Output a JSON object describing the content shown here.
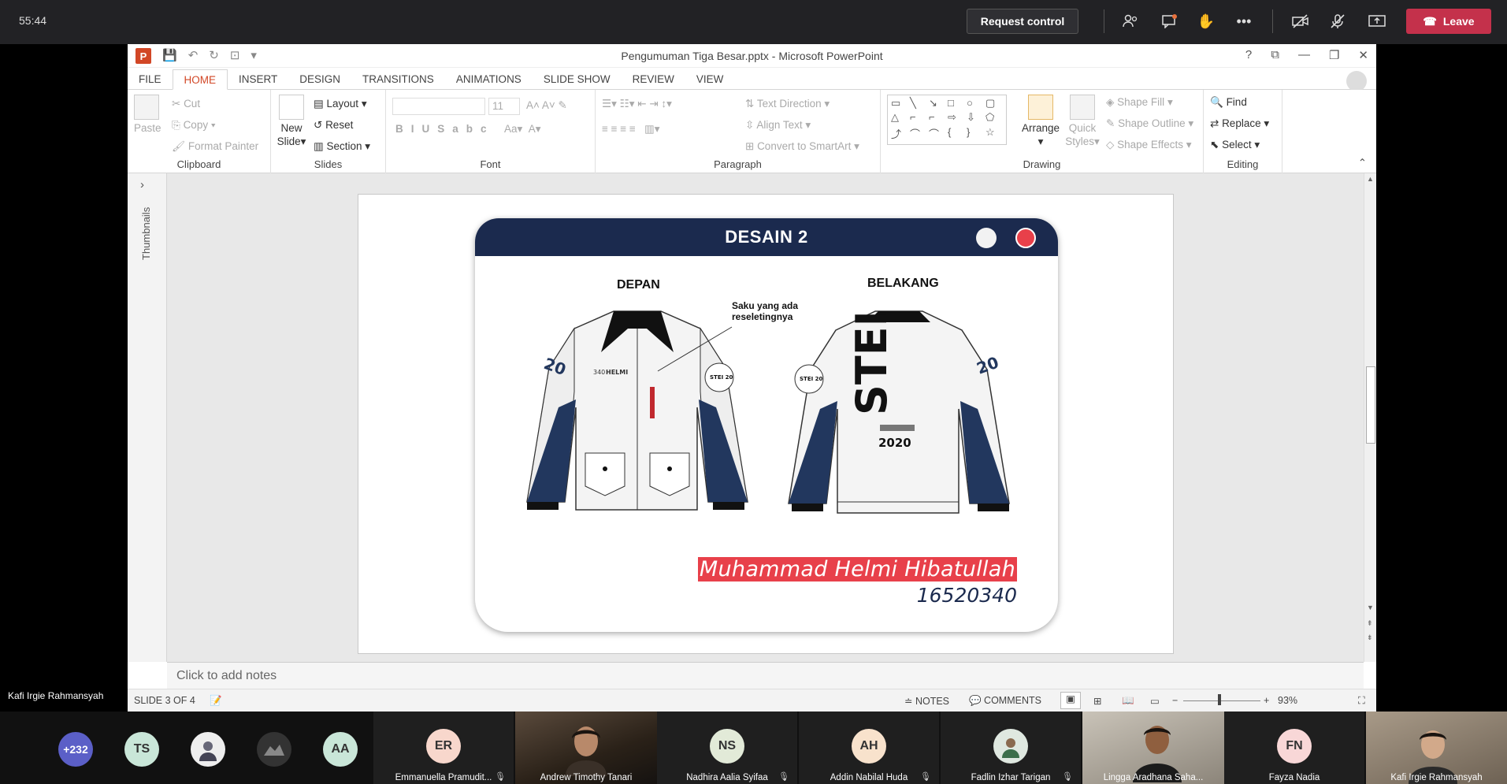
{
  "teams": {
    "timer": "55:44",
    "request_control": "Request control",
    "leave": "Leave",
    "icons": [
      "people-icon",
      "chat-icon",
      "raise-hand-icon",
      "more-icon",
      "camera-off-icon",
      "mic-off-icon",
      "share-icon"
    ],
    "self_name": "Kafi Irgie Rahmansyah",
    "overflow_count": "+232",
    "avatars": [
      {
        "initials": "TS",
        "color": "#c9e6d8"
      },
      {
        "initials": "AA",
        "color": "#c9e6d8"
      }
    ],
    "tiles": [
      {
        "initials": "ER",
        "name": "Emmanuella Pramudit...",
        "color": "#f8d7cc"
      },
      {
        "initials": "",
        "name": "Andrew Timothy Tanari",
        "color": ""
      },
      {
        "initials": "NS",
        "name": "Nadhira Aalia Syifaa",
        "color": "#e2ead8"
      },
      {
        "initials": "AH",
        "name": "Addin Nabilal Huda",
        "color": "#f8e2cc"
      },
      {
        "initials": "",
        "name": "Fadlin Izhar Tarigan",
        "color": ""
      },
      {
        "initials": "",
        "name": "Lingga Aradhana Saha...",
        "color": ""
      },
      {
        "initials": "FN",
        "name": "Fayza Nadia",
        "color": "#f8d7d7"
      },
      {
        "initials": "",
        "name": "Kafi Irgie Rahmansyah",
        "color": ""
      }
    ]
  },
  "ppt": {
    "title": "Pengumuman Tiga Besar.pptx - Microsoft PowerPoint",
    "tabs": [
      "FILE",
      "HOME",
      "INSERT",
      "DESIGN",
      "TRANSITIONS",
      "ANIMATIONS",
      "SLIDE SHOW",
      "REVIEW",
      "VIEW"
    ],
    "clipboard": {
      "paste": "Paste",
      "cut": "Cut",
      "copy": "Copy",
      "format_painter": "Format Painter",
      "label": "Clipboard"
    },
    "slides": {
      "new_slide": "New",
      "new_slide2": "Slide",
      "layout": "Layout",
      "reset": "Reset",
      "section": "Section",
      "label": "Slides"
    },
    "font": {
      "size": "11",
      "label": "Font"
    },
    "paragraph": {
      "text_direction": "Text Direction",
      "align_text": "Align Text",
      "convert": "Convert to SmartArt",
      "label": "Paragraph"
    },
    "drawing": {
      "arrange": "Arrange",
      "quick": "Quick",
      "styles": "Styles",
      "shape_fill": "Shape Fill",
      "shape_outline": "Shape Outline",
      "shape_effects": "Shape Effects",
      "label": "Drawing"
    },
    "editing": {
      "find": "Find",
      "replace": "Replace",
      "select": "Select",
      "label": "Editing"
    },
    "thumbnails": "Thumbnails",
    "notes_placeholder": "Click to add notes",
    "status": {
      "slide": "SLIDE 3 OF 4",
      "notes": "NOTES",
      "comments": "COMMENTS",
      "zoom": "93%"
    }
  },
  "slide": {
    "header": "DESAIN 2",
    "front": "DEPAN",
    "back": "BELAKANG",
    "pocket_note_1": "Saku yang ada",
    "pocket_note_2": "reseletingnya",
    "sleeve_number": "20",
    "chest_text": "340",
    "chest_text2": "HELMI",
    "back_text": "STEI",
    "back_year": "2020",
    "badge": "STEI 20",
    "name": "Muhammad Helmi Hibatullah",
    "nim": "16520340",
    "colors": {
      "navy": "#1b2a4e",
      "red": "#e8404a"
    }
  }
}
